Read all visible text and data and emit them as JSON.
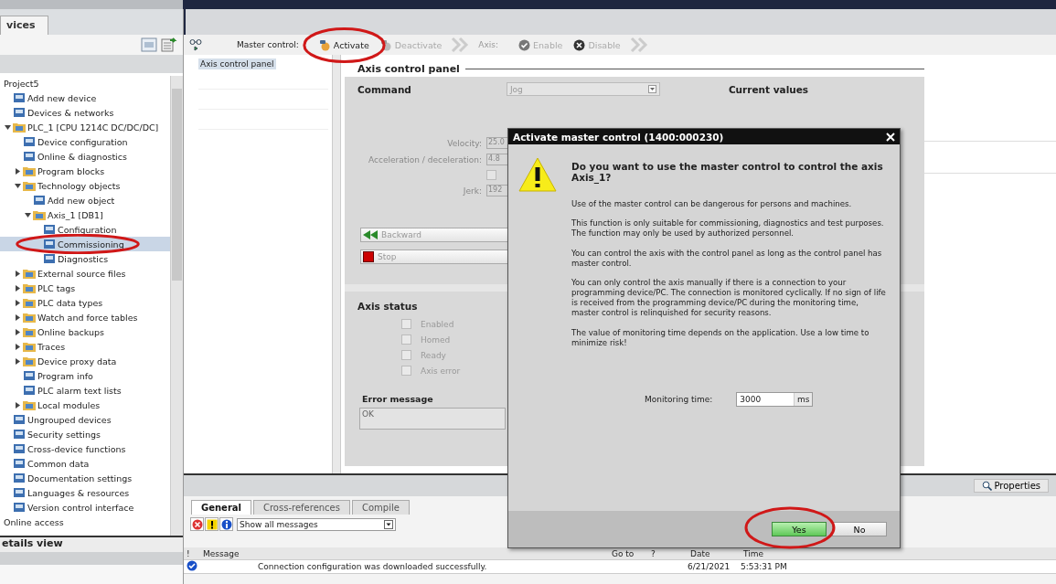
{
  "portal_tab": {
    "label": "vices"
  },
  "tree": [
    {
      "label": "Project5",
      "children": [
        {
          "label": "Add new device",
          "selected": false
        },
        {
          "label": "Devices & networks",
          "selected": false
        },
        {
          "label": "PLC_1 [CPU 1214C DC/DC/DC]",
          "selected": false,
          "expanded": true,
          "children": [
            {
              "label": "Device configuration",
              "selected": false
            },
            {
              "label": "Online & diagnostics",
              "selected": false
            },
            {
              "label": "Program blocks",
              "selected": false,
              "expanded": false
            },
            {
              "label": "Technology objects",
              "selected": false,
              "expanded": true,
              "children": [
                {
                  "label": "Add new object",
                  "selected": false
                },
                {
                  "label": "Axis_1 [DB1]",
                  "selected": false,
                  "expanded": true,
                  "children": [
                    {
                      "label": "Configuration",
                      "selected": false
                    },
                    {
                      "label": "Commissioning",
                      "selected": true,
                      "circled": true
                    },
                    {
                      "label": "Diagnostics",
                      "selected": false
                    }
                  ]
                }
              ]
            },
            {
              "label": "External source files",
              "selected": false,
              "expanded": false
            },
            {
              "label": "PLC tags",
              "selected": false,
              "expanded": false
            },
            {
              "label": "PLC data types",
              "selected": false,
              "expanded": false
            },
            {
              "label": "Watch and force tables",
              "selected": false,
              "expanded": false
            },
            {
              "label": "Online backups",
              "selected": false,
              "expanded": false
            },
            {
              "label": "Traces",
              "selected": false,
              "expanded": false
            },
            {
              "label": "Device proxy data",
              "selected": false,
              "expanded": false
            },
            {
              "label": "Program info",
              "selected": false
            },
            {
              "label": "PLC alarm text lists",
              "selected": false
            },
            {
              "label": "Local modules",
              "selected": false,
              "expanded": false
            }
          ]
        },
        {
          "label": "Ungrouped devices",
          "selected": false
        },
        {
          "label": "Security settings",
          "selected": false
        },
        {
          "label": "Cross-device functions",
          "selected": false
        },
        {
          "label": "Common data",
          "selected": false
        },
        {
          "label": "Documentation settings",
          "selected": false
        },
        {
          "label": "Languages & resources",
          "selected": false
        },
        {
          "label": "Version control interface",
          "selected": false
        }
      ]
    },
    {
      "label": "Online access",
      "selected": false
    }
  ],
  "details_view": {
    "title": "etails view"
  },
  "toolbar": {
    "master_label": "Master control:",
    "axis_label": "Axis:",
    "buttons": [
      {
        "label": "Activate",
        "kind": "activate",
        "disabled": false,
        "circled": true
      },
      {
        "label": "Deactivate",
        "kind": "deactivate",
        "disabled": true,
        "circled": false
      },
      {
        "label": "Enable",
        "kind": "enable",
        "disabled": true,
        "circled": false
      },
      {
        "label": "Disable",
        "kind": "disable",
        "disabled": true,
        "circled": false
      }
    ]
  },
  "subnav": [
    {
      "label": "Axis control panel",
      "selected": true
    }
  ],
  "panel": {
    "title": "Axis control panel",
    "command_label": "Command",
    "command_value": "Jog",
    "current_values_title": "Current values",
    "params": [
      {
        "label": "Velocity:",
        "value": "25.0"
      },
      {
        "label": "Acceleration / deceleration:",
        "value": "4.8"
      },
      {
        "label": "Jerk:",
        "value": "192"
      }
    ],
    "param_checkbox": {
      "checked": false,
      "disabled": true
    },
    "motion_buttons": [
      {
        "label": "Backward",
        "kind": "backward"
      },
      {
        "label": "Stop",
        "kind": "stop"
      }
    ],
    "status_title": "Axis status",
    "status": [
      {
        "label": "Enabled",
        "checked": false
      },
      {
        "label": "Homed",
        "checked": false
      },
      {
        "label": "Ready",
        "checked": false
      },
      {
        "label": "Axis error",
        "checked": false
      }
    ],
    "error_title": "Error message",
    "error_value": "OK"
  },
  "inspector": {
    "properties_button": "Properties",
    "tabs": [
      {
        "label": "General",
        "selected": true
      },
      {
        "label": "Cross-references",
        "selected": false
      },
      {
        "label": "Compile",
        "selected": false
      }
    ],
    "filters": [
      {
        "kind": "error",
        "on": true
      },
      {
        "kind": "warning",
        "on": true
      },
      {
        "kind": "info",
        "on": true
      }
    ],
    "filter_value": "Show all messages",
    "columns": [
      "!",
      "Message",
      "Go to",
      "?",
      "Date",
      "Time"
    ],
    "rows": [
      {
        "kind": "success",
        "message": "Connection configuration was downloaded successfully.",
        "date": "6/21/2021",
        "time": "5:53:31 PM"
      }
    ]
  },
  "dialog": {
    "title": "Activate master control (1400:000230)",
    "question": "Do you want to use the master control to control the axis Axis_1?",
    "paragraphs": [
      "Use of the master control can be dangerous for persons and machines.",
      "This function is only suitable for commissioning, diagnostics and test purposes. The function may only be used by authorized personnel.",
      "You can control the axis with the control panel as long as the control panel has master control.",
      "You can only control the axis manually if there is a connection to your programming device/PC. The connection is monitored cyclically. If no sign of life is received from the programming device/PC during the monitoring time, master control is relinquished for security reasons.",
      "The value of monitoring time depends on the application. Use a low time to minimize risk!"
    ],
    "field_label": "Monitoring time:",
    "field_value": "3000",
    "field_unit": "ms",
    "buttons": [
      {
        "label": "Yes",
        "default": true,
        "circled": true
      },
      {
        "label": "No",
        "default": false,
        "circled": false
      }
    ]
  }
}
